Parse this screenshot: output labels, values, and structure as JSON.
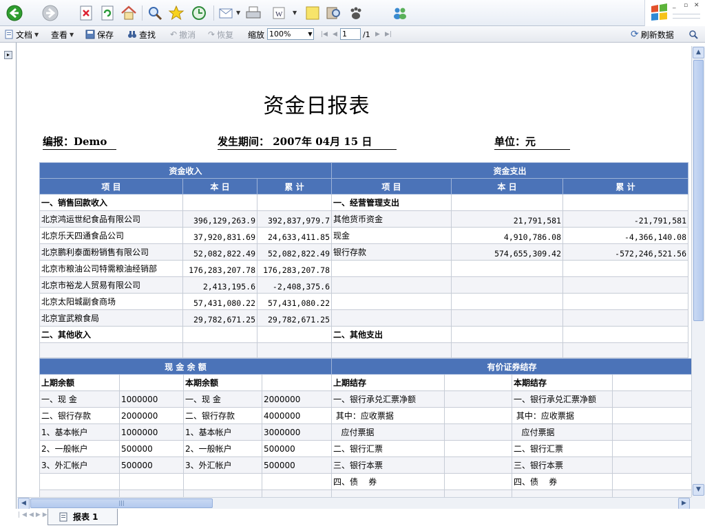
{
  "toolbar": {
    "doc": "文档",
    "view": "查看",
    "save": "保存",
    "find": "查找",
    "undo": "撤消",
    "redo": "恢复",
    "zoom_label": "缩放",
    "zoom_value": "100%",
    "page_value": "1",
    "page_total": "/1",
    "refresh": "刷新数据"
  },
  "report": {
    "title": "资金日报表",
    "editor": "编报：Demo",
    "period": "发生期间：  2007年  04月 15 日",
    "unit": "单位：元",
    "income": {
      "header": "资金收入",
      "cols": [
        "项  目",
        "本  日",
        "累  计"
      ],
      "rows": [
        [
          "一、销售回款收入",
          "",
          ""
        ],
        [
          "北京鸿运世纪食品有限公司",
          "396,129,263.9",
          "392,837,979.7"
        ],
        [
          "北京乐天四通食品公司",
          "37,920,831.69",
          "24,633,411.85"
        ],
        [
          "北京鹏利泰面粉销售有限公司",
          "52,082,822.49",
          "52,082,822.49"
        ],
        [
          "北京市粮油公司特需粮油经销部",
          "176,283,207.78",
          "176,283,207.78"
        ],
        [
          "北京市裕龙人贸易有限公司",
          "2,413,195.6",
          "-2,408,375.6"
        ],
        [
          "北京太阳城副食商场",
          "57,431,080.22",
          "57,431,080.22"
        ],
        [
          "北京宣武粮食局",
          "29,782,671.25",
          "29,782,671.25"
        ],
        [
          "二、其他收入",
          "",
          ""
        ],
        [
          "",
          "",
          ""
        ]
      ]
    },
    "expense": {
      "header": "资金支出",
      "cols": [
        "项  目",
        "本  日",
        "累  计"
      ],
      "rows": [
        [
          "一、经营管理支出",
          "",
          ""
        ],
        [
          "其他货币资金",
          "21,791,581",
          "-21,791,581"
        ],
        [
          "现金",
          "4,910,786.08",
          "-4,366,140.08"
        ],
        [
          "银行存款",
          "574,655,309.42",
          "-572,246,521.56"
        ],
        [
          "",
          "",
          ""
        ],
        [
          "",
          "",
          ""
        ],
        [
          "",
          "",
          ""
        ],
        [
          "",
          "",
          ""
        ],
        [
          "二、其他支出",
          "",
          ""
        ],
        [
          "",
          "",
          ""
        ]
      ]
    },
    "cash": {
      "header": "现  金  余  额",
      "prev_label": "上期余额",
      "curr_label": "本期余额",
      "rows": [
        [
          "一、现    金",
          "1000000",
          "一、现    金",
          "2000000"
        ],
        [
          "二、银行存款",
          "2000000",
          "二、银行存款",
          "4000000"
        ],
        [
          "1、基本帐户",
          "1000000",
          "1、基本帐户",
          "3000000"
        ],
        [
          "2、一般帐户",
          "500000",
          "2、一般帐户",
          "500000"
        ],
        [
          "3、外汇帐户",
          "500000",
          "3、外汇帐户",
          "500000"
        ],
        [
          "",
          "",
          "",
          ""
        ],
        [
          "",
          "",
          "",
          ""
        ]
      ]
    },
    "securities": {
      "header": "有价证券结存",
      "prev_label": "上期结存",
      "curr_label": "本期结存",
      "rows": [
        [
          "一、银行承兑汇票净额",
          "",
          "一、银行承兑汇票净额",
          ""
        ],
        [
          " 其中：应收票据",
          "",
          " 其中：应收票据",
          ""
        ],
        [
          "   应付票据",
          "",
          "   应付票据",
          ""
        ],
        [
          "二、银行汇票",
          "",
          "二、银行汇票",
          ""
        ],
        [
          "三、银行本票",
          "",
          "三、银行本票",
          ""
        ],
        [
          "四、债    券",
          "",
          "四、债    券",
          ""
        ],
        [
          "",
          "",
          "",
          ""
        ]
      ]
    }
  },
  "sheet_tab": "报表 1",
  "colors": {
    "header_blue": "#4b73b8",
    "grid": "#c6ccd6"
  }
}
